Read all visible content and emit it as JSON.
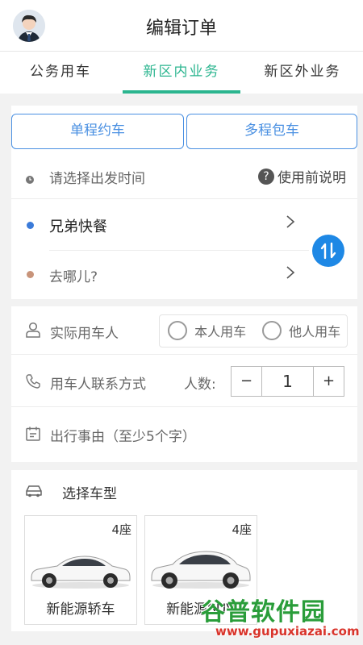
{
  "header": {
    "title": "编辑订单",
    "avatar_icon": "user-avatar"
  },
  "tabs": [
    {
      "label": "公务用车",
      "active": false
    },
    {
      "label": "新区内业务",
      "active": true
    },
    {
      "label": "新区外业务",
      "active": false
    }
  ],
  "trip": {
    "single_label": "单程约车",
    "multi_label": "多程包车",
    "time_placeholder": "请选择出发时间",
    "help_label": "使用前说明",
    "origin": "兄弟快餐",
    "destination_placeholder": "去哪儿?",
    "colors": {
      "accent": "#4a90e2",
      "origin_dot": "#3b7bd9",
      "dest_dot": "#c8947a",
      "tab_active": "#2bb58f",
      "swap_button": "#1e88e5"
    }
  },
  "passenger": {
    "user_label": "实际用车人",
    "self_option": "本人用车",
    "other_option": "他人用车",
    "contact_label": "用车人联系方式",
    "count_label": "人数:",
    "count_value": "1",
    "minus": "−",
    "plus": "+",
    "reason_placeholder": "出行事由（至少5个字）"
  },
  "vehicle": {
    "section_label": "选择车型",
    "cars": [
      {
        "seats": "4座",
        "name": "新能源轿车"
      },
      {
        "seats": "4座",
        "name": "新能源SUV"
      }
    ]
  },
  "watermark": {
    "title": "谷普软件园",
    "url": "www.gupuxiazai.com"
  }
}
